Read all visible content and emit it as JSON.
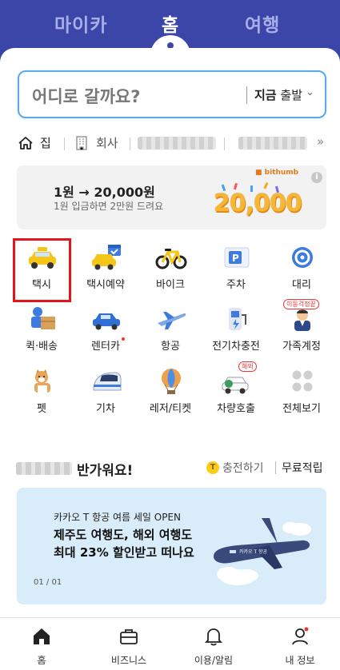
{
  "top_tabs": {
    "mycar": "마이카",
    "home": "홈",
    "travel": "여행"
  },
  "search": {
    "placeholder": "어디로 갈까요?",
    "depart_now": "지금",
    "depart": "출발"
  },
  "quick": {
    "home": "집",
    "work": "회사"
  },
  "banner": {
    "title": "1원 → 20,000원",
    "subtitle": "1원 입금하면 2만원 드려요",
    "brand": "bithumb",
    "amount": "20,000"
  },
  "services": [
    {
      "label": "택시",
      "icon": "taxi-icon"
    },
    {
      "label": "택시예약",
      "icon": "taxi-reservation-icon"
    },
    {
      "label": "바이크",
      "icon": "bike-icon"
    },
    {
      "label": "주차",
      "icon": "parking-icon"
    },
    {
      "label": "대리",
      "icon": "designated-driver-icon"
    },
    {
      "label": "퀵·배송",
      "icon": "delivery-icon"
    },
    {
      "label": "렌터카",
      "icon": "rental-car-icon"
    },
    {
      "label": "항공",
      "icon": "airplane-icon"
    },
    {
      "label": "전기차충전",
      "icon": "ev-charger-icon"
    },
    {
      "label": "가족계정",
      "icon": "family-account-icon"
    },
    {
      "label": "펫",
      "icon": "pet-icon"
    },
    {
      "label": "기차",
      "icon": "train-icon"
    },
    {
      "label": "레저/티켓",
      "icon": "balloon-icon"
    },
    {
      "label": "차량호출",
      "icon": "car-call-icon"
    },
    {
      "label": "전체보기",
      "icon": "view-all-icon"
    }
  ],
  "tags": {
    "family": "이동걱정끝",
    "overseas": "해외"
  },
  "welcome": {
    "greeting": "반가워요!",
    "charge": "충전하기",
    "free": "무료적립"
  },
  "promo": {
    "small": "카카오 T 항공 여름 세일 OPEN",
    "line1": "제주도 여행도, 해외 여행도",
    "line2": "최대 23% 할인받고 떠나요",
    "page": "01 / 01",
    "plane_text": "카카오 T 항공"
  },
  "nav": {
    "home": "홈",
    "business": "비즈니스",
    "usage": "이용/알림",
    "profile": "내 정보"
  },
  "colors": {
    "brand_blue": "#3b46a8",
    "accent_red": "#e4141b",
    "promo_bg": "#d8ecf9"
  }
}
